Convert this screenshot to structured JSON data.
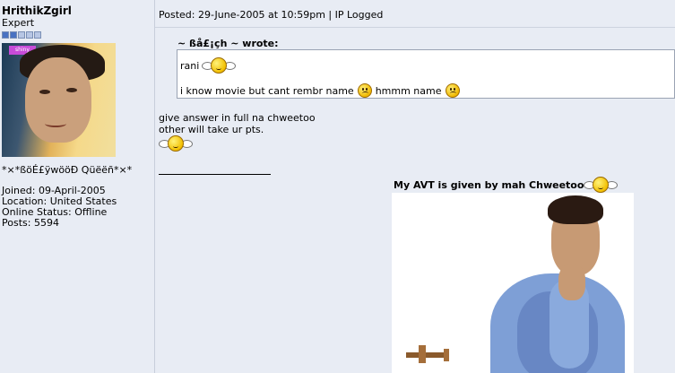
{
  "sidebar": {
    "username": "HrithikZgirl",
    "rank": "Expert",
    "stars_filled": 2,
    "stars_total": 5,
    "avatar_badge": "shiny",
    "signature_name": "*×*ßöÉ£ÿwööÐ Qüëëñ*×*",
    "joined": "Joined: 09-April-2005",
    "location": "Location: United States",
    "online_status": "Online Status: Offline",
    "posts": "Posts: 5594"
  },
  "post": {
    "posted_line": "Posted: 29-June-2005 at 10:59pm | IP Logged",
    "quote": {
      "title": "~ ßå£¡çh ~ wrote:",
      "line1": "rani",
      "line2_part1": "i know movie but cant rembr name",
      "line2_part2": "hmmm name"
    },
    "body_line1": "give answer in full na chweetoo",
    "body_line2": "other will take ur pts.",
    "signature_caption": "My AVT is given by mah Chweetoo"
  },
  "icons": {
    "clap_smiley": "clapping-smiley-icon",
    "sad_smiley": "sad-smiley-icon"
  },
  "colors": {
    "background": "#e8ecf4",
    "star_on": "#4a72c2",
    "star_off": "#b7c6e4"
  }
}
